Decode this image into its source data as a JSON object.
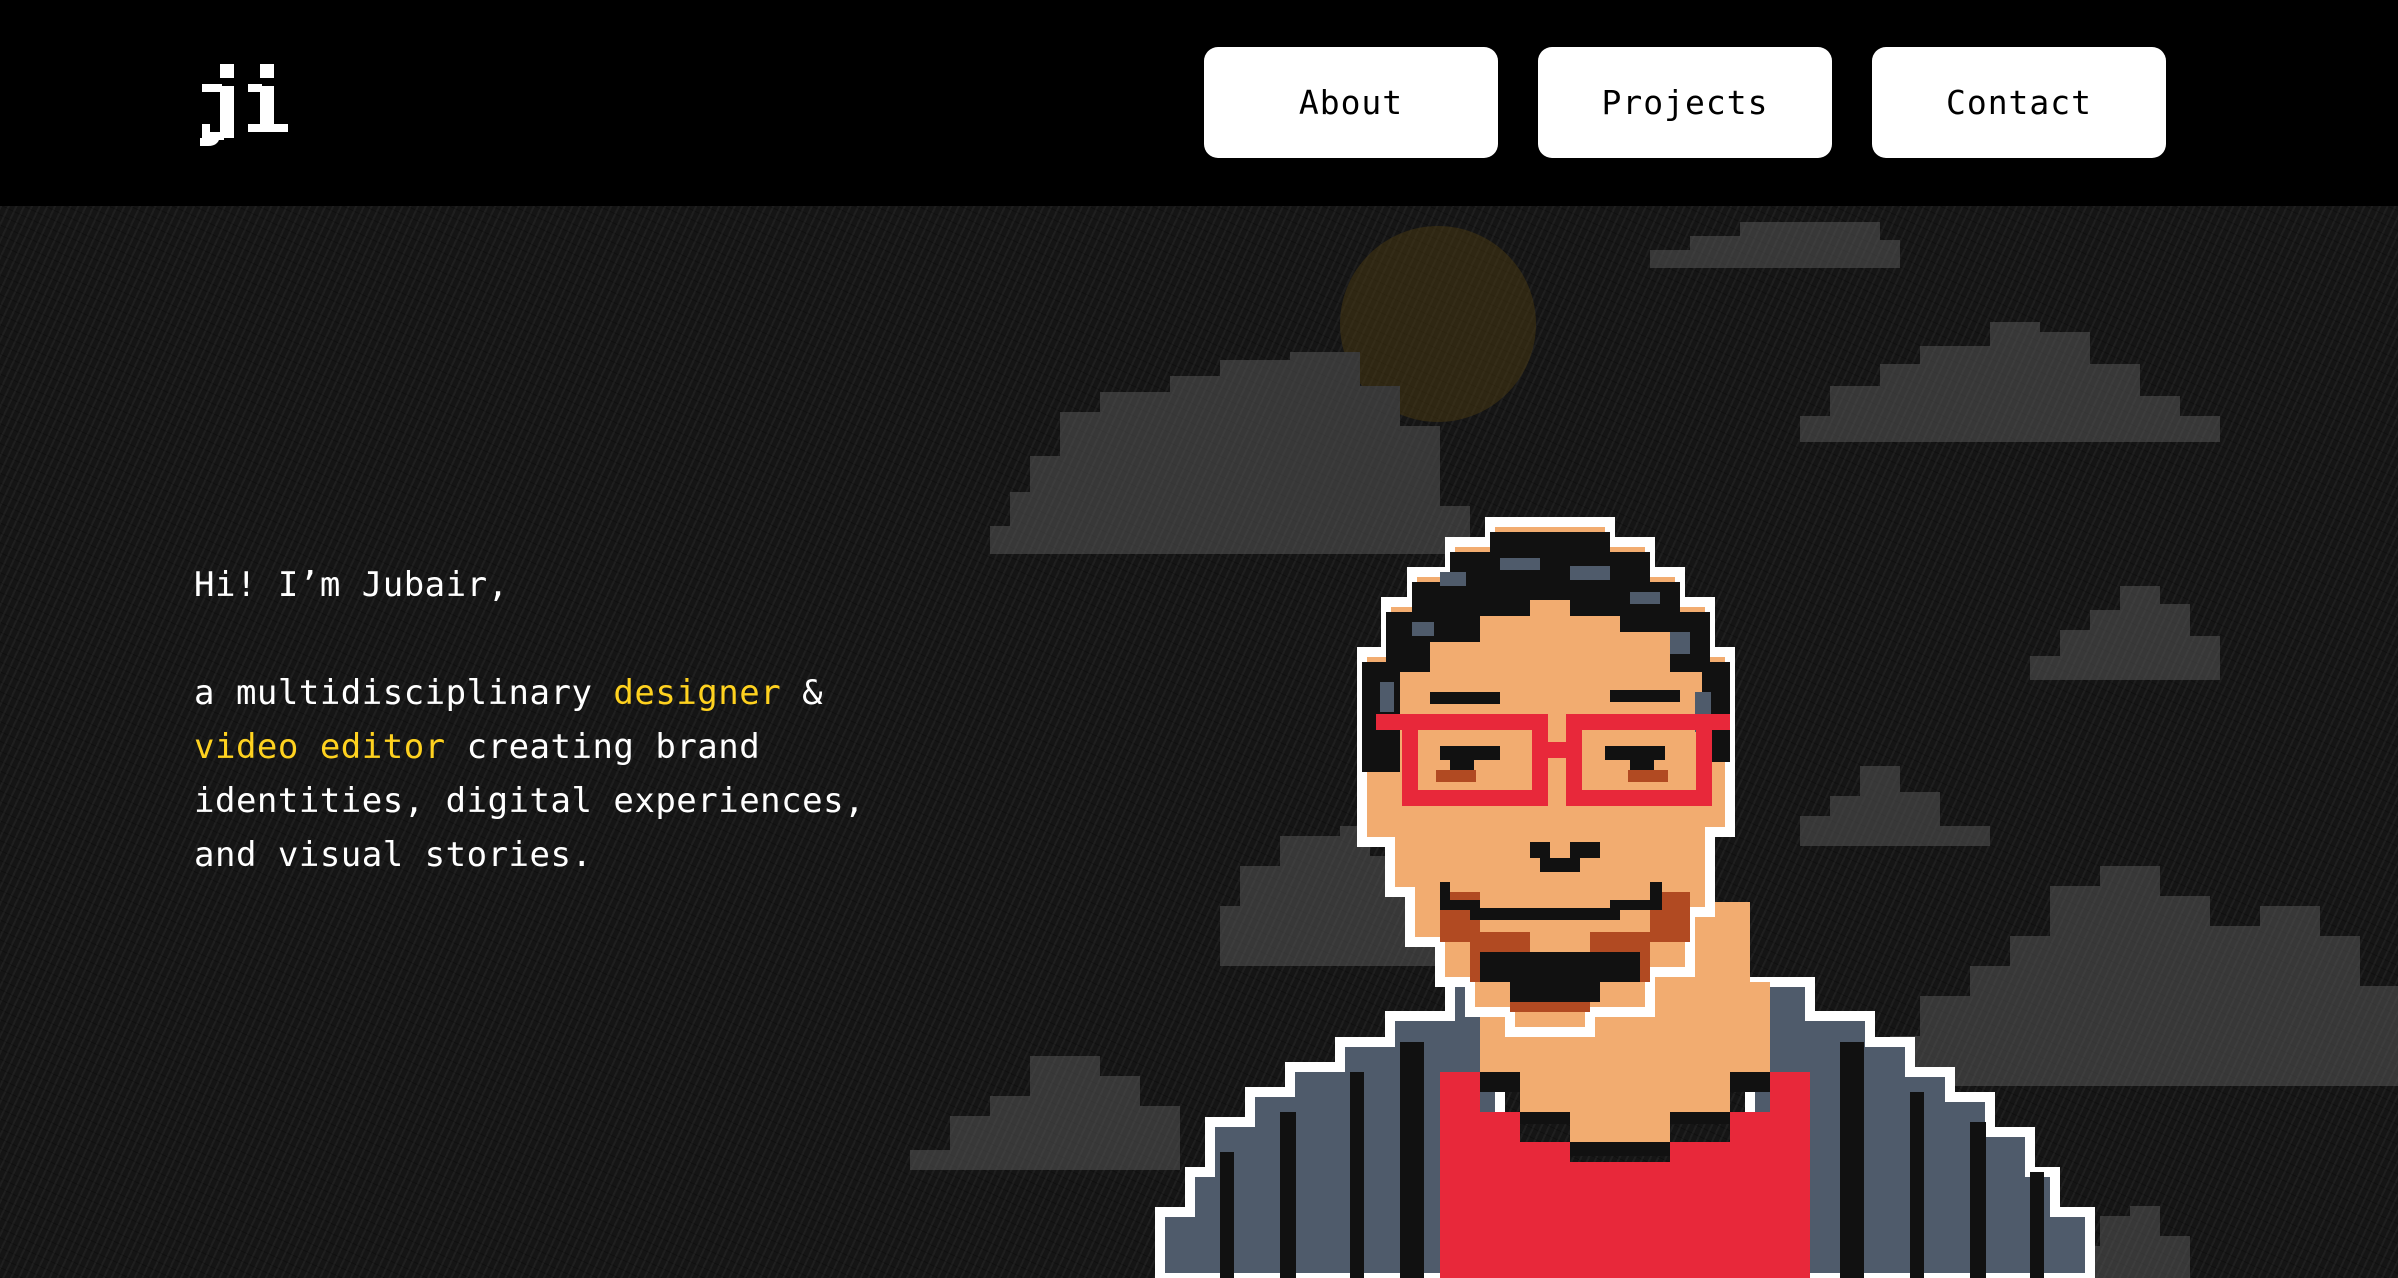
{
  "header": {
    "logo_text": "ji",
    "nav": [
      {
        "label": "About"
      },
      {
        "label": "Projects"
      },
      {
        "label": "Contact"
      }
    ]
  },
  "hero": {
    "greeting": "Hi! I’m Jubair,",
    "desc_prefix": "a multidisciplinary",
    "highlight_1": "designer",
    "amp": "&",
    "highlight_2": "video editor",
    "desc_rest": "creating brand identities, digital experiences, and visual stories."
  },
  "colors": {
    "background": "#000000",
    "hero_background": "#151515",
    "accent_yellow": "#ffd21f",
    "shirt_red": "#e8283a",
    "skin": "#f2ac70",
    "jacket": "#4f5b6b"
  },
  "icons": {
    "portrait": "pixel-art-self-portrait",
    "clouds": "pixel-cloud-icon",
    "sun": "sun-icon"
  }
}
